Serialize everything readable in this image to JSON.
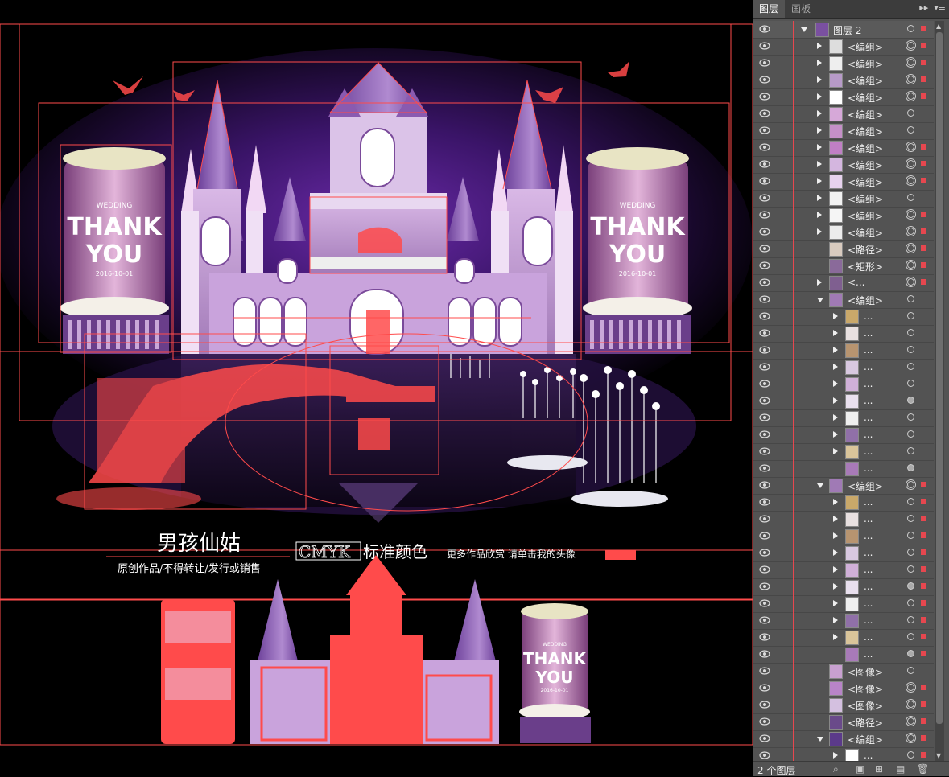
{
  "panel": {
    "tabs": [
      "图层",
      "画板"
    ],
    "status": "2 个图层",
    "top_layer": "图层 2",
    "rows": [
      {
        "label": "<编组>",
        "indent": 1,
        "expand": "right",
        "thumb": "#ddd",
        "target": "dbl",
        "sel": true
      },
      {
        "label": "<编组>",
        "indent": 1,
        "expand": "right",
        "thumb": "#eee",
        "target": "dbl",
        "sel": true
      },
      {
        "label": "<编组>",
        "indent": 1,
        "expand": "right",
        "thumb": "#b79ac8",
        "target": "dbl",
        "sel": true
      },
      {
        "label": "<编组>",
        "indent": 1,
        "expand": "right",
        "thumb": "#fff",
        "target": "dbl",
        "sel": true
      },
      {
        "label": "<编组>",
        "indent": 1,
        "expand": "right",
        "thumb": "#d6a8d8",
        "target": "single",
        "sel": false
      },
      {
        "label": "<编组>",
        "indent": 1,
        "expand": "right",
        "thumb": "#c58fc8",
        "target": "single",
        "sel": false
      },
      {
        "label": "<编组>",
        "indent": 1,
        "expand": "right",
        "thumb": "#c07fc5",
        "target": "dbl",
        "sel": true
      },
      {
        "label": "<编组>",
        "indent": 1,
        "expand": "right",
        "thumb": "#d4b6df",
        "target": "dbl",
        "sel": true
      },
      {
        "label": "<编组>",
        "indent": 1,
        "expand": "right",
        "thumb": "#e7d2ee",
        "target": "dbl",
        "sel": true
      },
      {
        "label": "<编组>",
        "indent": 1,
        "expand": "right",
        "thumb": "#f2f2f2",
        "target": "single",
        "sel": false
      },
      {
        "label": "<编组>",
        "indent": 1,
        "expand": "right",
        "thumb": "#f5f5f5",
        "target": "dbl",
        "sel": true
      },
      {
        "label": "<编组>",
        "indent": 1,
        "expand": "right",
        "thumb": "#ececec",
        "target": "dbl",
        "sel": true
      },
      {
        "label": "<路径>",
        "indent": 1,
        "expand": "none",
        "thumb": "#d9cbbf",
        "target": "dbl",
        "sel": true
      },
      {
        "label": "<矩形>",
        "indent": 1,
        "expand": "none",
        "thumb": "#8a6a9a",
        "target": "dbl",
        "sel": true
      },
      {
        "label": "<...",
        "indent": 1,
        "expand": "right",
        "thumb": "#7f5f90",
        "target": "dbl",
        "sel": true
      },
      {
        "label": "<编组>",
        "indent": 1,
        "expand": "down",
        "thumb": "#a07ab5",
        "target": "single",
        "sel": false
      },
      {
        "label": "...",
        "indent": 2,
        "expand": "right",
        "thumb": "#c9a86a",
        "target": "single",
        "sel": false
      },
      {
        "label": "...",
        "indent": 2,
        "expand": "right",
        "thumb": "#e8e0e0",
        "target": "single",
        "sel": false
      },
      {
        "label": "...",
        "indent": 2,
        "expand": "right",
        "thumb": "#b79470",
        "target": "single",
        "sel": false
      },
      {
        "label": "...",
        "indent": 2,
        "expand": "right",
        "thumb": "#d8c8e0",
        "target": "single",
        "sel": false
      },
      {
        "label": "...",
        "indent": 2,
        "expand": "right",
        "thumb": "#d0b0d8",
        "target": "single",
        "sel": false
      },
      {
        "label": "...",
        "indent": 2,
        "expand": "right",
        "thumb": "#e9e0ee",
        "target": "fill",
        "sel": false
      },
      {
        "label": "...",
        "indent": 2,
        "expand": "right",
        "thumb": "#efefef",
        "target": "single",
        "sel": false
      },
      {
        "label": "...",
        "indent": 2,
        "expand": "right",
        "thumb": "#9070a8",
        "target": "single",
        "sel": false
      },
      {
        "label": "...",
        "indent": 2,
        "expand": "right",
        "thumb": "#d9c49a",
        "target": "single",
        "sel": false
      },
      {
        "label": "...",
        "indent": 2,
        "expand": "none",
        "thumb": "#a87ab8",
        "target": "fill",
        "sel": false
      },
      {
        "label": "<编组>",
        "indent": 1,
        "expand": "down",
        "thumb": "#a07ab5",
        "target": "dbl",
        "sel": true
      },
      {
        "label": "...",
        "indent": 2,
        "expand": "right",
        "thumb": "#c9a86a",
        "target": "single",
        "sel": true
      },
      {
        "label": "...",
        "indent": 2,
        "expand": "right",
        "thumb": "#e8e0e0",
        "target": "single",
        "sel": true
      },
      {
        "label": "...",
        "indent": 2,
        "expand": "right",
        "thumb": "#b79470",
        "target": "single",
        "sel": true
      },
      {
        "label": "...",
        "indent": 2,
        "expand": "right",
        "thumb": "#d8c8e0",
        "target": "single",
        "sel": true
      },
      {
        "label": "...",
        "indent": 2,
        "expand": "right",
        "thumb": "#d0b0d8",
        "target": "single",
        "sel": true
      },
      {
        "label": "...",
        "indent": 2,
        "expand": "right",
        "thumb": "#e9e0ee",
        "target": "fill",
        "sel": true
      },
      {
        "label": "...",
        "indent": 2,
        "expand": "right",
        "thumb": "#efefef",
        "target": "single",
        "sel": true
      },
      {
        "label": "...",
        "indent": 2,
        "expand": "right",
        "thumb": "#9070a8",
        "target": "single",
        "sel": true
      },
      {
        "label": "...",
        "indent": 2,
        "expand": "right",
        "thumb": "#d9c49a",
        "target": "single",
        "sel": true
      },
      {
        "label": "...",
        "indent": 2,
        "expand": "none",
        "thumb": "#a87ab8",
        "target": "fill",
        "sel": true
      },
      {
        "label": "<图像>",
        "indent": 1,
        "expand": "none",
        "thumb": "#c8a0d0",
        "target": "single",
        "sel": false
      },
      {
        "label": "<图像>",
        "indent": 1,
        "expand": "none",
        "thumb": "#b884c8",
        "target": "dbl",
        "sel": true
      },
      {
        "label": "<图像>",
        "indent": 1,
        "expand": "none",
        "thumb": "#d4c0e0",
        "target": "dbl",
        "sel": true
      },
      {
        "label": "<路径>",
        "indent": 1,
        "expand": "none",
        "thumb": "#6a4a8a",
        "target": "dbl",
        "sel": true
      },
      {
        "label": "<编组>",
        "indent": 1,
        "expand": "down",
        "thumb": "#5b3a8a",
        "target": "dbl",
        "sel": true
      },
      {
        "label": "...",
        "indent": 2,
        "expand": "right",
        "thumb": "#ffffff",
        "target": "single",
        "sel": true
      }
    ]
  },
  "canvas": {
    "title_cn": "男孩仙姑",
    "subtitle_cn": "原创作品/不得转让/发行或销售",
    "cmyk": "CMYK",
    "std_color": "标准颜色",
    "more": "更多作品欣赏 请单击我的头像",
    "pillar_wedding": "WEDDING",
    "pillar_thank": "THANK",
    "pillar_you": "YOU",
    "pillar_date": "2016-10-01"
  },
  "colors": {
    "selection": "#ff4b4b",
    "layer_bar": "#e6474f",
    "panel_bg": "#535353"
  }
}
